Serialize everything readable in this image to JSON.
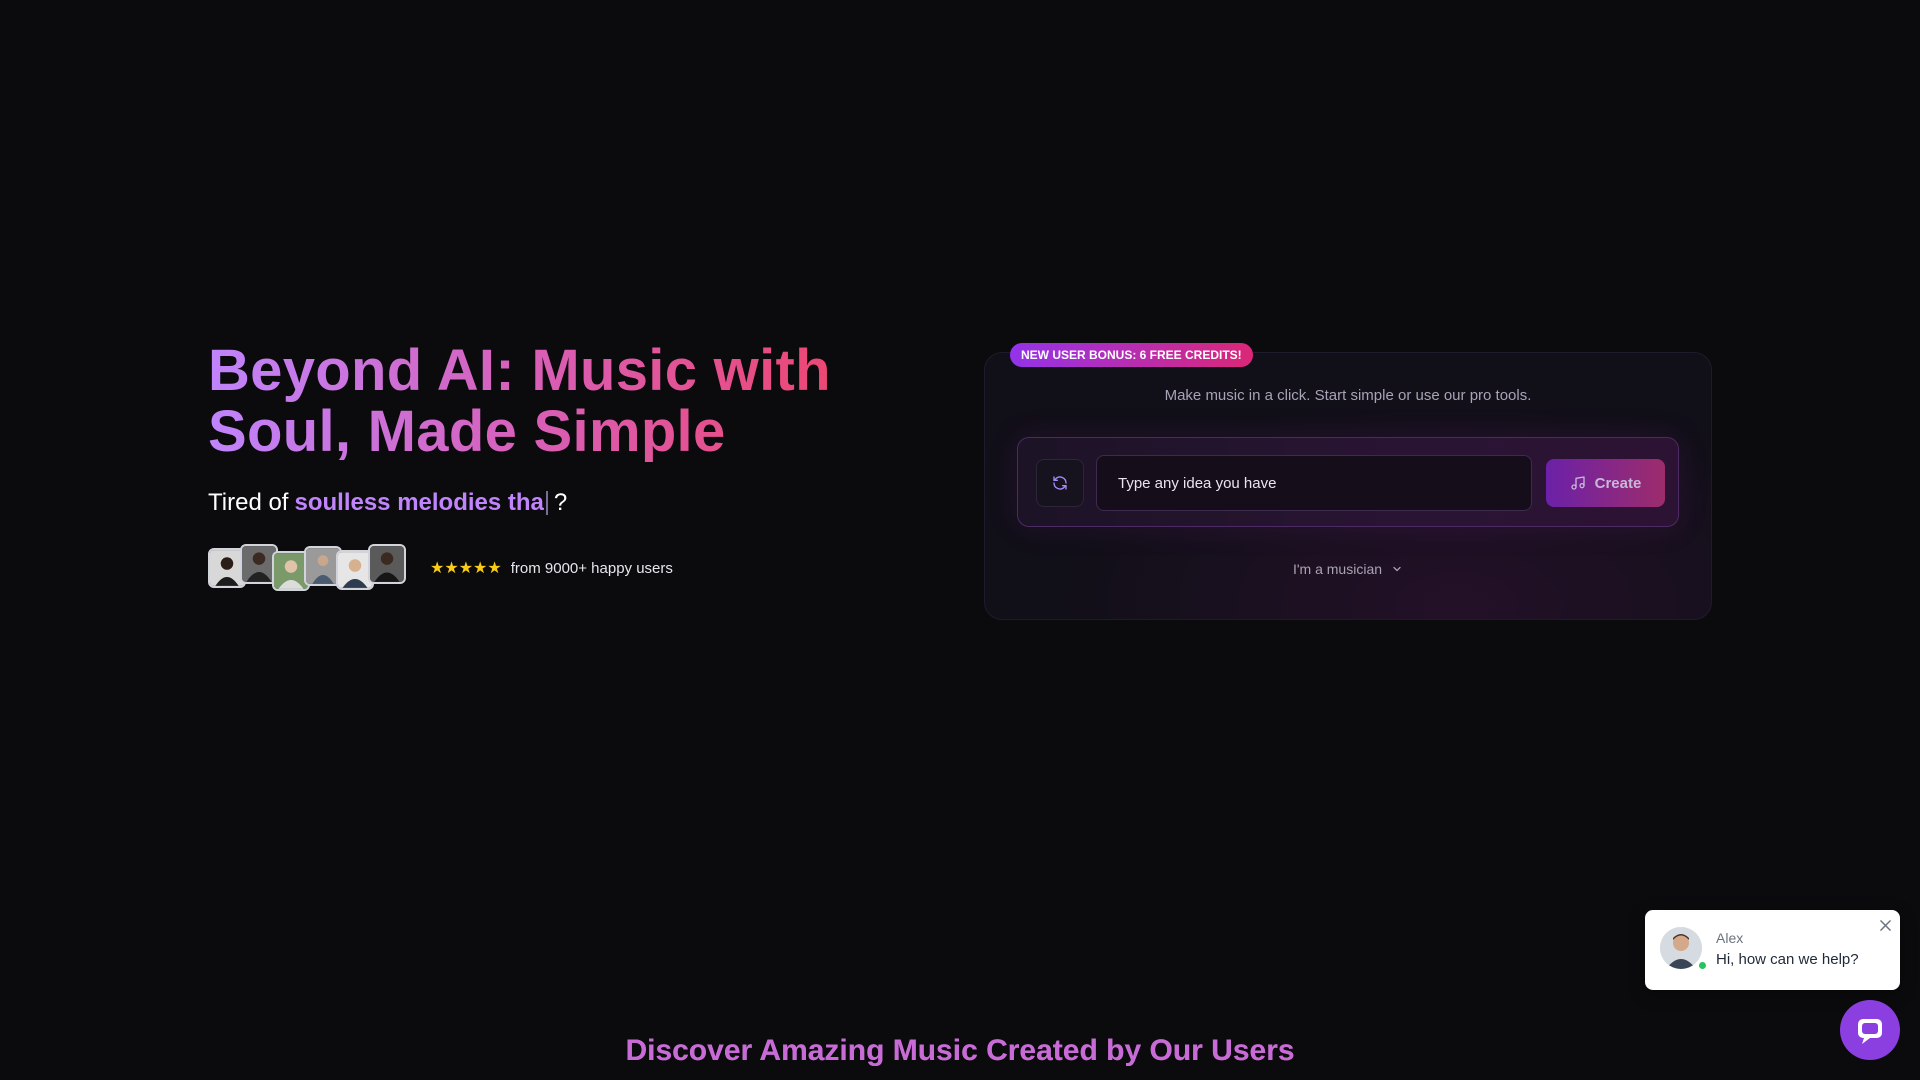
{
  "hero": {
    "title_line1": "Beyond AI: Music with",
    "title_line2": "Soul, Made Simple",
    "tagline_prefix": "Tired of",
    "tagline_highlight": "soulless melodies tha",
    "tagline_suffix": "?"
  },
  "social_proof": {
    "stars": "★★★★★",
    "rating_value": 5,
    "text": "from 9000+ happy users"
  },
  "create_card": {
    "badge": "NEW USER BONUS: 6 FREE CREDITS!",
    "subtitle": "Make music in a click. Start simple or use our pro tools.",
    "input_placeholder": "Type any idea you have",
    "input_value": "",
    "create_label": "Create",
    "musician_label": "I'm a musician"
  },
  "discover": {
    "title": "Discover Amazing Music Created by Our Users"
  },
  "chat": {
    "agent_name": "Alex",
    "message": "Hi, how can we help?"
  },
  "colors": {
    "background": "#0b0b0d",
    "accent_purple": "#c084fc",
    "accent_pink": "#f43f5e",
    "badge_gradient_start": "#9333ea",
    "badge_gradient_end": "#db2777",
    "star": "#facc15",
    "online": "#22c55e",
    "launcher": "#8b3fe0"
  },
  "icons": {
    "refresh": "refresh-icon",
    "music": "music-note-icon",
    "chevron": "chevron-down-icon",
    "close": "close-icon",
    "chat": "chat-bubble-icon"
  }
}
